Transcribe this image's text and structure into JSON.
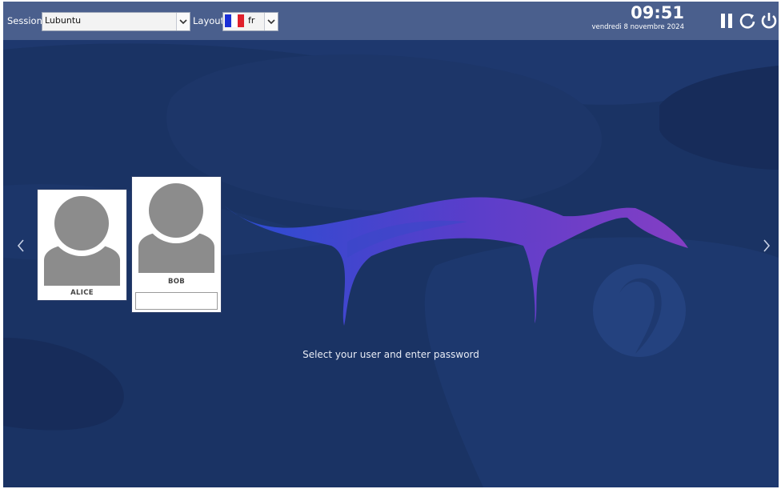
{
  "topbar": {
    "session_label": "Session",
    "session_value": "Lubuntu",
    "layout_label": "Layout",
    "layout_value": "fr",
    "layout_flag": "france-flag"
  },
  "clock": {
    "time": "09:51",
    "date": "vendredi 8 novembre 2024"
  },
  "power": [
    "pause-icon",
    "restart-icon",
    "power-icon"
  ],
  "users": [
    {
      "name": "ALICE",
      "selected": false
    },
    {
      "name": "BOB",
      "selected": true
    }
  ],
  "prompt": "Select your user and enter password",
  "colors": {
    "background": "#1a3364",
    "topbar": "#4a5f8d",
    "ribbon_start": "#2a4fd8",
    "ribbon_end": "#8a3ec9"
  }
}
